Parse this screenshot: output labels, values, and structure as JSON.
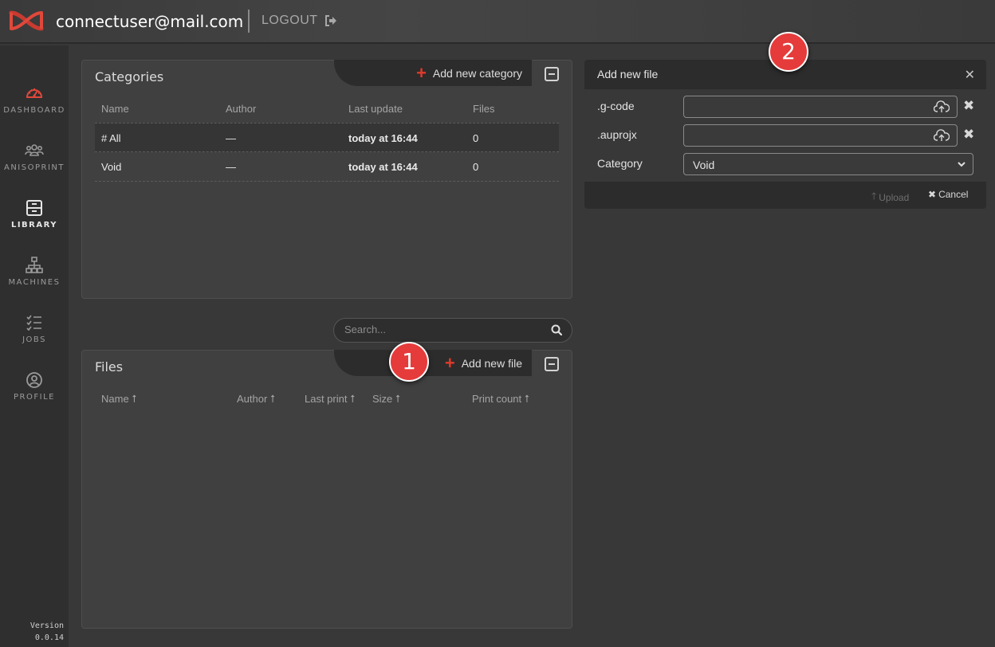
{
  "header": {
    "user_email": "connectuser@mail.com",
    "logout_label": "LOGOUT",
    "accent_color": "#e23a2a"
  },
  "sidebar": {
    "items": [
      {
        "label": "DASHBOARD",
        "icon": "speedometer-icon",
        "active": false
      },
      {
        "label": "ANISOPRINT",
        "icon": "users-group-icon",
        "active": false
      },
      {
        "label": "LIBRARY",
        "icon": "archive-icon",
        "active": true
      },
      {
        "label": "MACHINES",
        "icon": "network-icon",
        "active": false
      },
      {
        "label": "JOBS",
        "icon": "checklist-icon",
        "active": false
      },
      {
        "label": "PROFILE",
        "icon": "user-circle-icon",
        "active": false
      }
    ],
    "version_label": "Version",
    "version_number": "0.0.14"
  },
  "categories": {
    "title": "Categories",
    "add_label": "Add new category",
    "columns": [
      "Name",
      "Author",
      "Last update",
      "Files"
    ],
    "rows": [
      {
        "name": "# All",
        "author": "—",
        "last_update": "today at 16:44",
        "files": "0"
      },
      {
        "name": "Void",
        "author": "—",
        "last_update": "today at 16:44",
        "files": "0"
      }
    ]
  },
  "search": {
    "placeholder": "Search..."
  },
  "files": {
    "title": "Files",
    "add_label": "Add new file",
    "columns": [
      "Name ⭡",
      "Author ⭡",
      "Last print ⭡",
      "Size ⭡",
      "Print count ⭡"
    ]
  },
  "dialog": {
    "title": "Add new file",
    "gcode_label": ".g-code",
    "auprojx_label": ".auprojx",
    "category_label": "Category",
    "category_value": "Void",
    "upload_label": "Upload",
    "cancel_label": "Cancel"
  },
  "badges": {
    "step1": "1",
    "step2": "2"
  }
}
